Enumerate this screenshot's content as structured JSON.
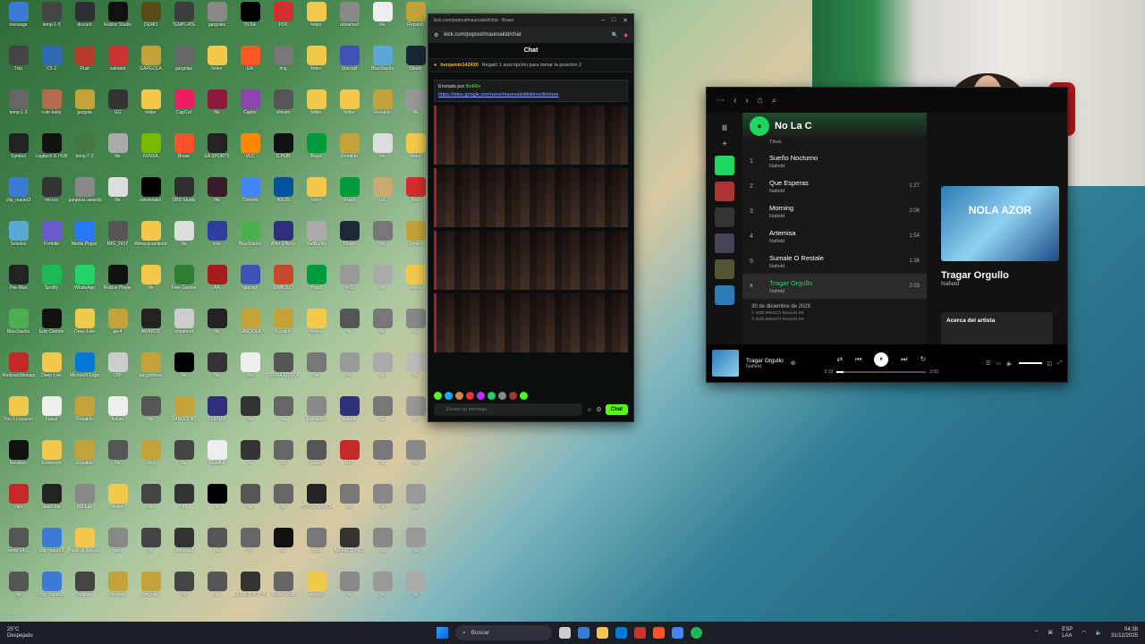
{
  "desktop": {
    "icons": [
      {
        "label": "message",
        "color": "#3a7bd5"
      },
      {
        "label": "temp-1-3",
        "color": "#444"
      },
      {
        "label": "discord",
        "color": "#2c2f33"
      },
      {
        "label": "Roblox Studio",
        "color": "#111"
      },
      {
        "label": "DEMO",
        "color": "#5a4a1a"
      },
      {
        "label": "TEMPLATE",
        "color": "#3d3d3d"
      },
      {
        "label": "gargolas",
        "color": "#888"
      },
      {
        "label": "TikTok",
        "color": "#000"
      },
      {
        "label": "PDF",
        "color": "#d32f2f"
      },
      {
        "label": "folder",
        "color": "#f2c94c"
      },
      {
        "label": "unnamed",
        "color": "#888"
      },
      {
        "label": "file",
        "color": "#eee"
      },
      {
        "label": "Ronaldo",
        "color": "#c4a23a"
      },
      {
        "label": "7zip",
        "color": "#444"
      },
      {
        "label": "CS 2",
        "color": "#2f6bb5"
      },
      {
        "label": "Rust",
        "color": "#b53b2a"
      },
      {
        "label": "valorant",
        "color": "#cc3333"
      },
      {
        "label": "GARGOLA",
        "color": "#c4a23a"
      },
      {
        "label": "gargolas",
        "color": "#666"
      },
      {
        "label": "folder",
        "color": "#f2c94c"
      },
      {
        "label": "EA",
        "color": "#ff5722"
      },
      {
        "label": "img",
        "color": "#777"
      },
      {
        "label": "folder",
        "color": "#f2c94c"
      },
      {
        "label": "Upscayl",
        "color": "#3f51b5"
      },
      {
        "label": "BlueStacks",
        "color": "#5ba7d6"
      },
      {
        "label": "Steam",
        "color": "#1b2838"
      },
      {
        "label": "temp-1-3",
        "color": "#666"
      },
      {
        "label": "cute-baby",
        "color": "#b56b4e"
      },
      {
        "label": "gargola",
        "color": "#c4a23a"
      },
      {
        "label": "GG",
        "color": "#333"
      },
      {
        "label": "folder",
        "color": "#f2c94c"
      },
      {
        "label": "CapCut",
        "color": "#e91e63"
      },
      {
        "label": "file",
        "color": "#8e1a3b"
      },
      {
        "label": "Captor",
        "color": "#8e44ad"
      },
      {
        "label": "stream",
        "color": "#555"
      },
      {
        "label": "folder",
        "color": "#f2c94c"
      },
      {
        "label": "folder",
        "color": "#f2c94c"
      },
      {
        "label": "Ronaldo",
        "color": "#c4a23a"
      },
      {
        "label": "file",
        "color": "#999"
      },
      {
        "label": "Symbol",
        "color": "#222"
      },
      {
        "label": "Logitech G HUB",
        "color": "#111"
      },
      {
        "label": "temp-7-3",
        "color": "#447744"
      },
      {
        "label": "file",
        "color": "#aaa"
      },
      {
        "label": "NVIDIA",
        "color": "#76b900"
      },
      {
        "label": "Brave",
        "color": "#fb542b"
      },
      {
        "label": "EA SPORTS",
        "color": "#222"
      },
      {
        "label": "VLC",
        "color": "#ff8800"
      },
      {
        "label": "G HUB",
        "color": "#111"
      },
      {
        "label": "Brasil",
        "color": "#009c3b"
      },
      {
        "label": "Ronaldo",
        "color": "#c4a23a"
      },
      {
        "label": "file",
        "color": "#ddd"
      },
      {
        "label": "folder",
        "color": "#f2c94c"
      },
      {
        "label": "clip_mauro3",
        "color": "#3a7bd5"
      },
      {
        "label": "micros",
        "color": "#333"
      },
      {
        "label": "gargolas awards",
        "color": "#888"
      },
      {
        "label": "file",
        "color": "#ddd"
      },
      {
        "label": "elevenlabs",
        "color": "#000"
      },
      {
        "label": "OBS Studio",
        "color": "#302e31"
      },
      {
        "label": "file",
        "color": "#3a1a2a"
      },
      {
        "label": "Chrome",
        "color": "#4285f4"
      },
      {
        "label": "ASUS",
        "color": "#00539b"
      },
      {
        "label": "folder",
        "color": "#f2c94c"
      },
      {
        "label": "Brasil",
        "color": "#009c3b"
      },
      {
        "label": "LoL",
        "color": "#c8aa6e"
      },
      {
        "label": "Red",
        "color": "#d32f2f"
      },
      {
        "label": "Solution",
        "color": "#5ba7d6"
      },
      {
        "label": "Fortnite",
        "color": "#6a5acd"
      },
      {
        "label": "Media Player",
        "color": "#2979ff"
      },
      {
        "label": "IMG_2417",
        "color": "#555"
      },
      {
        "label": "Almacenamiento",
        "color": "#f2c94c"
      },
      {
        "label": "file",
        "color": "#ddd"
      },
      {
        "label": "icon",
        "color": "#2f3e9e"
      },
      {
        "label": "BlueStacks",
        "color": "#4caf50"
      },
      {
        "label": "After Effects",
        "color": "#2f2f7a"
      },
      {
        "label": "StatBuddy",
        "color": "#aaa"
      },
      {
        "label": "Steam",
        "color": "#1b2838"
      },
      {
        "label": "file",
        "color": "#777"
      },
      {
        "label": "Ronaldo",
        "color": "#c4a23a"
      },
      {
        "label": "Pac-Man",
        "color": "#222"
      },
      {
        "label": "Spotify",
        "color": "#1db954"
      },
      {
        "label": "WhatsApp",
        "color": "#25d366"
      },
      {
        "label": "Roblox Player",
        "color": "#111"
      },
      {
        "label": "file",
        "color": "#f2c94c"
      },
      {
        "label": "Free Games",
        "color": "#2e7d32"
      },
      {
        "label": "AA",
        "color": "#a61b1b"
      },
      {
        "label": "upscayl",
        "color": "#3f51b5"
      },
      {
        "label": "SIMBOLO",
        "color": "#c44a2a"
      },
      {
        "label": "Brasil",
        "color": "#009c3b"
      },
      {
        "label": "IMG",
        "color": "#999"
      },
      {
        "label": "file",
        "color": "#aaa"
      },
      {
        "label": "folder",
        "color": "#f2c94c"
      },
      {
        "label": "BlueStacks",
        "color": "#4caf50"
      },
      {
        "label": "Epic Games",
        "color": "#111"
      },
      {
        "label": "Deep-Live",
        "color": "#f2c94c"
      },
      {
        "label": "gs-4",
        "color": "#c4a23a"
      },
      {
        "label": "AWARDS",
        "color": "#222"
      },
      {
        "label": "unnamed",
        "color": "#ccc"
      },
      {
        "label": "file",
        "color": "#222"
      },
      {
        "label": "GARGOLA",
        "color": "#c4a23a"
      },
      {
        "label": "Ronaldo",
        "color": "#c4a23a"
      },
      {
        "label": "folder",
        "color": "#f2c94c"
      },
      {
        "label": "file",
        "color": "#555"
      },
      {
        "label": "file",
        "color": "#777"
      },
      {
        "label": "file",
        "color": "#888"
      },
      {
        "label": "ModpackManager",
        "color": "#c62828"
      },
      {
        "label": "Deep-Live",
        "color": "#f2c94c"
      },
      {
        "label": "Microsoft Edge",
        "color": "#0078d7"
      },
      {
        "label": "OIP",
        "color": "#ccc"
      },
      {
        "label": "gargolinhas",
        "color": "#c4a23a"
      },
      {
        "label": "file",
        "color": "#000"
      },
      {
        "label": "file",
        "color": "#333"
      },
      {
        "label": "file",
        "color": "#eee"
      },
      {
        "label": "TERNA EDITORE",
        "color": "#555"
      },
      {
        "label": "file",
        "color": "#777"
      },
      {
        "label": "file",
        "color": "#999"
      },
      {
        "label": "file",
        "color": "#aaa"
      },
      {
        "label": "file",
        "color": "#bbb"
      },
      {
        "label": "Pes 6 Locazos",
        "color": "#f2c94c"
      },
      {
        "label": "Futsal",
        "color": "#eee"
      },
      {
        "label": "Ronaldo",
        "color": "#c4a23a"
      },
      {
        "label": "fixture",
        "color": "#eee"
      },
      {
        "label": "file",
        "color": "#555"
      },
      {
        "label": "GARGOLAS",
        "color": "#c4a23a"
      },
      {
        "label": "TERNAS",
        "color": "#2f2f7a"
      },
      {
        "label": "file",
        "color": "#333"
      },
      {
        "label": "file",
        "color": "#666"
      },
      {
        "label": "transicion",
        "color": "#888"
      },
      {
        "label": "awards",
        "color": "#2f2f7a"
      },
      {
        "label": "file",
        "color": "#777"
      },
      {
        "label": "file",
        "color": "#999"
      },
      {
        "label": "Revision",
        "color": "#111"
      },
      {
        "label": "Extension",
        "color": "#f2c94c"
      },
      {
        "label": "Ronaldo",
        "color": "#c4a23a"
      },
      {
        "label": "file",
        "color": "#555"
      },
      {
        "label": "mici",
        "color": "#c4a23a"
      },
      {
        "label": "file",
        "color": "#444"
      },
      {
        "label": "Mundial",
        "color": "#eee"
      },
      {
        "label": "file",
        "color": "#333"
      },
      {
        "label": "file",
        "color": "#666"
      },
      {
        "label": "mauro",
        "color": "#555"
      },
      {
        "label": "Red",
        "color": "#c62828"
      },
      {
        "label": "file",
        "color": "#777"
      },
      {
        "label": "file",
        "color": "#888"
      },
      {
        "label": "Valo",
        "color": "#c62828"
      },
      {
        "label": "black-bar",
        "color": "#222"
      },
      {
        "label": "MS Lab",
        "color": "#888"
      },
      {
        "label": "folder",
        "color": "#f2c94c"
      },
      {
        "label": "file",
        "color": "#444"
      },
      {
        "label": "HIK",
        "color": "#333"
      },
      {
        "label": "file",
        "color": "#000"
      },
      {
        "label": "file",
        "color": "#555"
      },
      {
        "label": "file",
        "color": "#666"
      },
      {
        "label": "TOP DONADORES",
        "color": "#222"
      },
      {
        "label": "file",
        "color": "#777"
      },
      {
        "label": "file",
        "color": "#888"
      },
      {
        "label": "file",
        "color": "#999"
      },
      {
        "label": "temp-14-1",
        "color": "#555"
      },
      {
        "label": "clip_mauro2",
        "color": "#3a7bd5"
      },
      {
        "label": "Pack de Recursos",
        "color": "#f2c94c"
      },
      {
        "label": "flayer",
        "color": "#888"
      },
      {
        "label": "file",
        "color": "#444"
      },
      {
        "label": "unnamed",
        "color": "#333"
      },
      {
        "label": "file",
        "color": "#555"
      },
      {
        "label": "file",
        "color": "#666"
      },
      {
        "label": "file",
        "color": "#111"
      },
      {
        "label": "comp",
        "color": "#777"
      },
      {
        "label": "AWARDS PRO",
        "color": "#333"
      },
      {
        "label": "file",
        "color": "#888"
      },
      {
        "label": "file",
        "color": "#999"
      },
      {
        "label": "file",
        "color": "#555"
      },
      {
        "label": "clip_mauro2",
        "color": "#3a7bd5"
      },
      {
        "label": "pelicula",
        "color": "#444"
      },
      {
        "label": "gargola",
        "color": "#c4a23a"
      },
      {
        "label": "gargolas",
        "color": "#c4a23a"
      },
      {
        "label": "file",
        "color": "#444"
      },
      {
        "label": "file",
        "color": "#555"
      },
      {
        "label": "EL MEJOR PHONE",
        "color": "#333"
      },
      {
        "label": "Travis Scott",
        "color": "#666"
      },
      {
        "label": "awards",
        "color": "#f2c94c"
      },
      {
        "label": "file",
        "color": "#888"
      },
      {
        "label": "file",
        "color": "#999"
      },
      {
        "label": "file",
        "color": "#aaa"
      }
    ]
  },
  "kick": {
    "tab_title": "kick.com/popout/mauroakid/chat - Brave",
    "url": "kick.com/popout/mauroakid/chat",
    "chat_title": "Chat",
    "pinned_user": "benjamin142420",
    "pinned_desc": "Regaló 1 suscripción para tomar la posición 2",
    "message_sent_by": "Enviado por",
    "message_bot": "BotRix",
    "message_link": "https://sites.google.com/view/mauroakidlinktree/linktree",
    "input_placeholder": "Enviar un mensaje",
    "send_label": "Chat"
  },
  "spotify": {
    "playlist_title": "No La C",
    "col_title": "Título",
    "tracks": [
      {
        "num": "1",
        "title": "Sueño Nocturno",
        "artist": "Nafield",
        "duration": ""
      },
      {
        "num": "2",
        "title": "Que Esperas",
        "artist": "Nafield",
        "duration": "1:27"
      },
      {
        "num": "3",
        "title": "Morning",
        "artist": "Nafield",
        "duration": "2:06"
      },
      {
        "num": "4",
        "title": "Artemisa",
        "artist": "Nafield",
        "duration": "1:54"
      },
      {
        "num": "5",
        "title": "Sumale O Restale",
        "artist": "Nafield",
        "duration": "1:36"
      },
      {
        "num": "⏸",
        "title": "Tragar Orgullo",
        "artist": "Nafield",
        "duration": "2:03"
      }
    ],
    "release_date": "30 de diciembre de 2025",
    "rights_1": "© 2025 9954273 Records DK",
    "rights_2": "℗ 2025 9954273 Records DK",
    "cover_text": "NOLA AZOR",
    "now_title": "Tragar Orgullo",
    "now_artist": "Nafield",
    "about_label": "Acerca del artista",
    "time_elapsed": "0:10",
    "time_total": "2:03",
    "progress": 0.08
  },
  "taskbar": {
    "temp": "25°C",
    "weather": "Despejado",
    "search_placeholder": "Buscar",
    "lang_1": "ESP",
    "lang_2": "LAA",
    "time": "04:38",
    "date": "31/12/2025"
  }
}
